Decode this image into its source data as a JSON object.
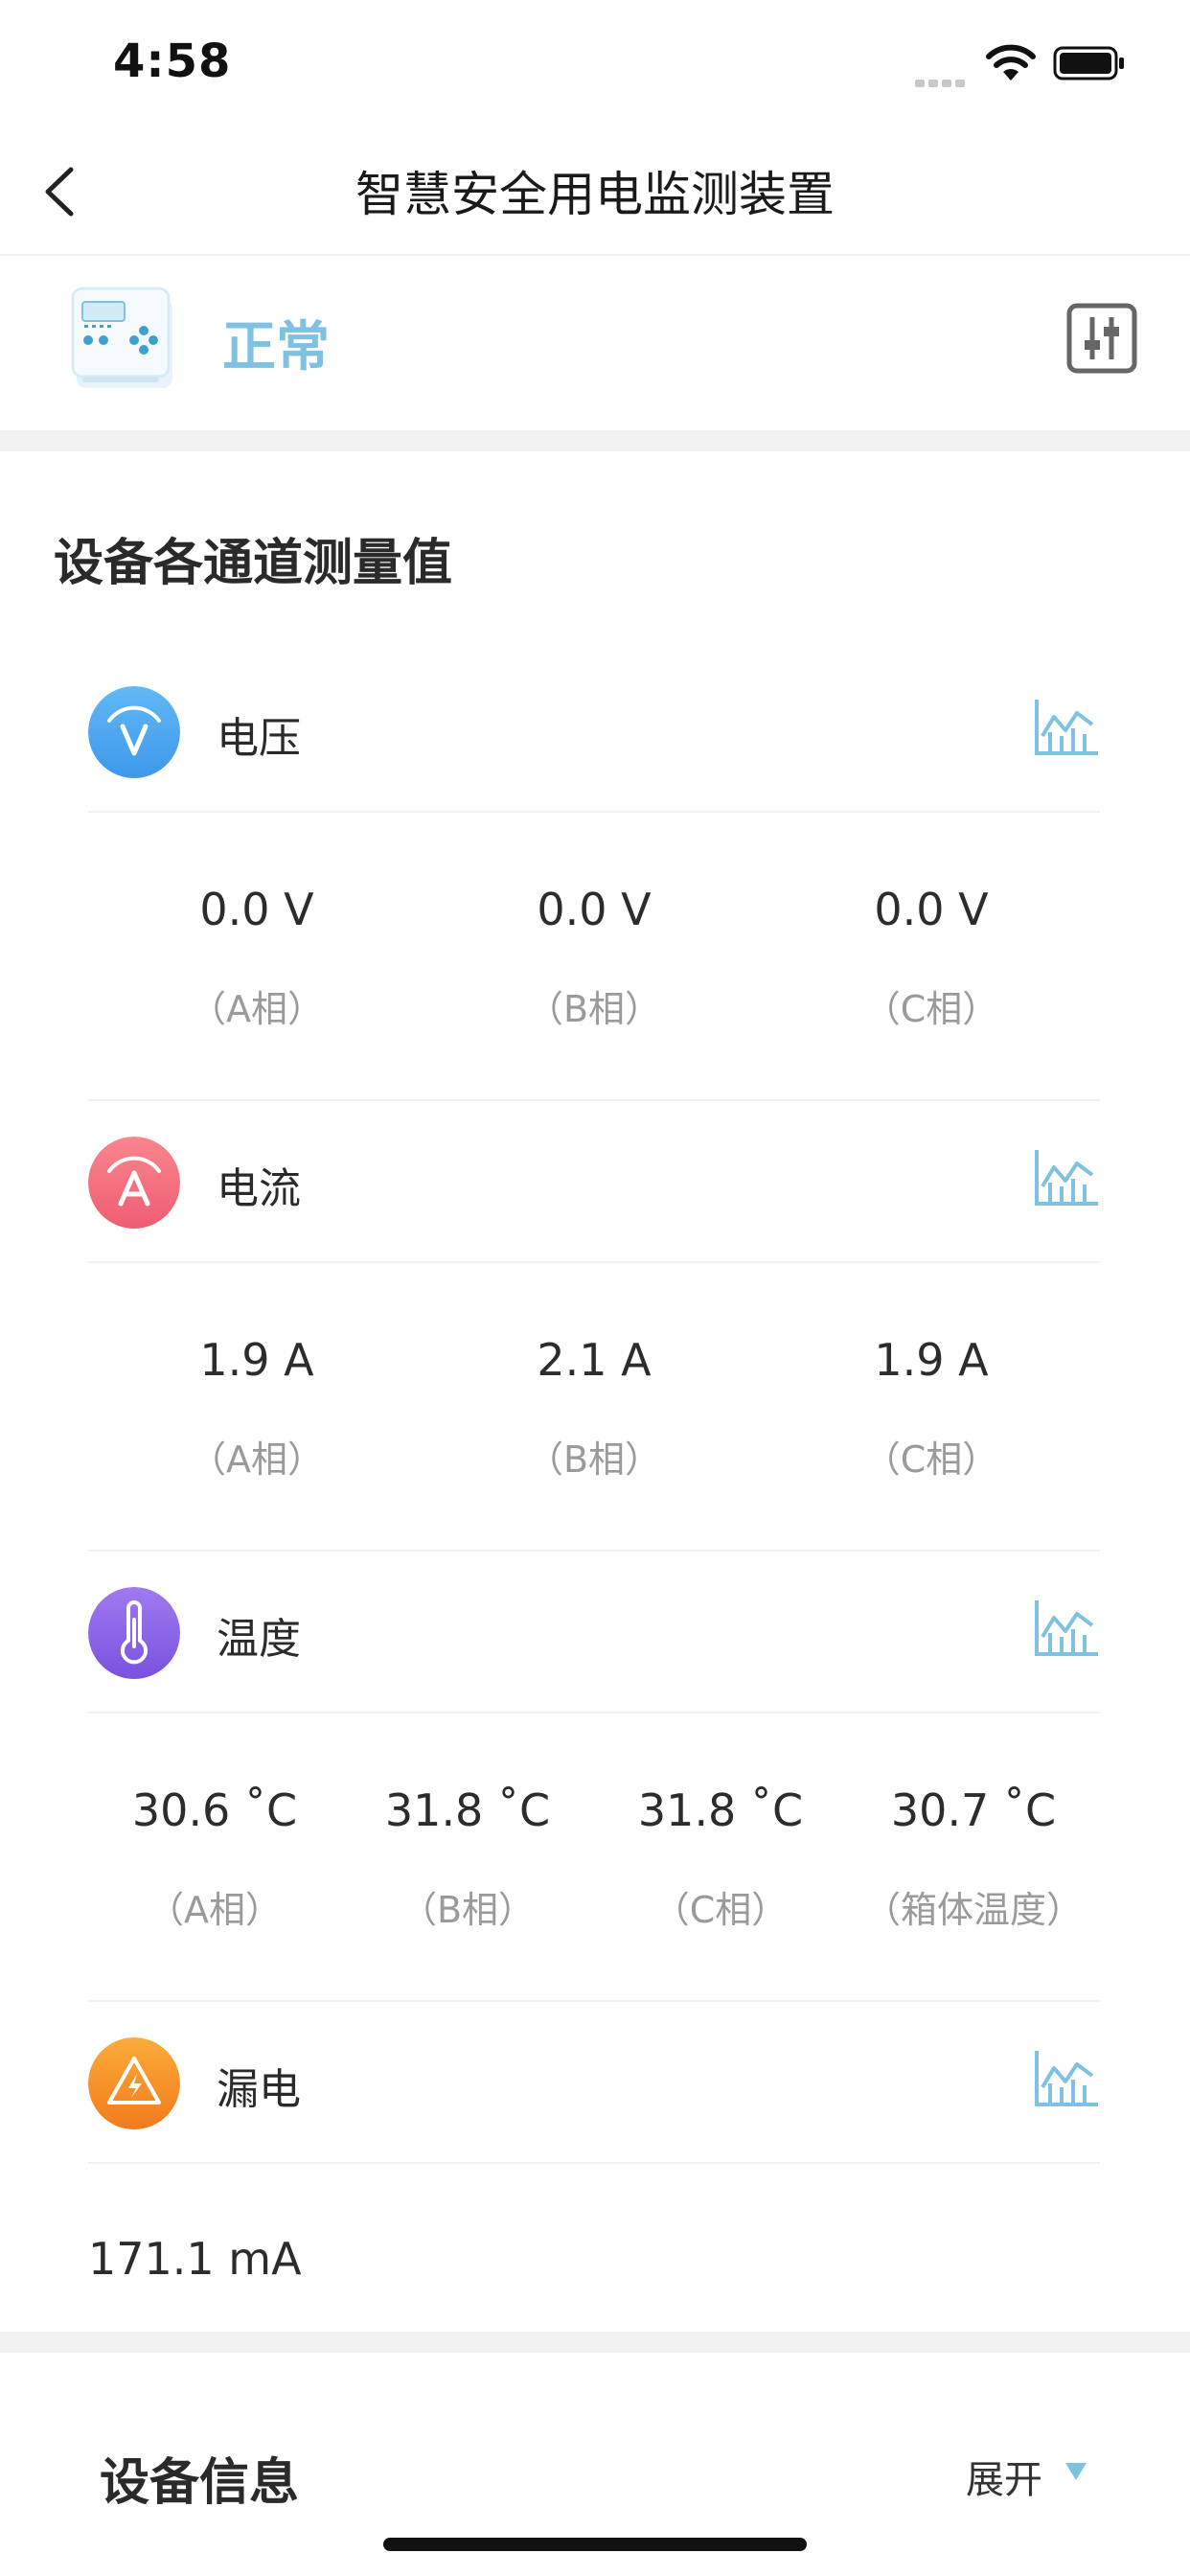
{
  "status_bar": {
    "time": "4:58"
  },
  "nav": {
    "title": "智慧安全用电监测装置"
  },
  "device": {
    "status": "正常",
    "status_color": "#7ec1e0"
  },
  "section": {
    "title": "设备各通道测量值"
  },
  "groups": [
    {
      "label": "电压",
      "icon": "voltage-icon",
      "color": "#49a8f0",
      "values": [
        "0.0 V",
        "0.0 V",
        "0.0 V"
      ],
      "phases": [
        "（A相）",
        "（B相）",
        "（C相）"
      ]
    },
    {
      "label": "电流",
      "icon": "current-icon",
      "color": "#f1677a",
      "values": [
        "1.9 A",
        "2.1 A",
        "1.9 A"
      ],
      "phases": [
        "（A相）",
        "（B相）",
        "（C相）"
      ]
    },
    {
      "label": "温度",
      "icon": "temperature-icon",
      "color": "#8a60e4",
      "values": [
        "30.6 ˚C",
        "31.8 ˚C",
        "31.8 ˚C",
        "30.7 ˚C"
      ],
      "phases": [
        "（A相）",
        "（B相）",
        "（C相）",
        "（箱体温度）"
      ]
    },
    {
      "label": "漏电",
      "icon": "leakage-icon",
      "color": "#f38a22",
      "values": [
        "171.1 mA"
      ],
      "phases": []
    }
  ],
  "info": {
    "title": "设备信息",
    "expand_label": "展开"
  },
  "accent_color": "#7ec1e0"
}
